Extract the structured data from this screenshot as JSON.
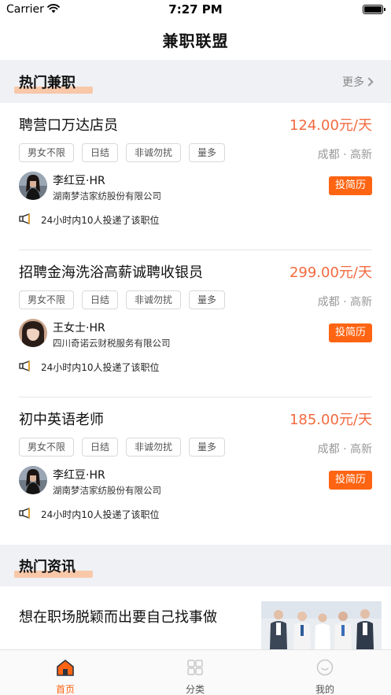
{
  "status": {
    "carrier": "Carrier",
    "time": "7:27 PM"
  },
  "nav": {
    "title": "兼职联盟"
  },
  "hot_jobs": {
    "title": "热门兼职",
    "more": "更多"
  },
  "jobs": [
    {
      "title": "聘营口万达店员",
      "salary": "124.00元/天",
      "tags": [
        "男女不限",
        "日结",
        "非诚勿扰",
        "量多"
      ],
      "location": "成都 · 高新",
      "hr_name": "李红豆·HR",
      "company": "湖南梦洁家纺股份有限公司",
      "apply": "投简历",
      "applied_note": "24小时内10人投递了该职位"
    },
    {
      "title": "招聘金海洗浴高薪诚聘收银员",
      "salary": "299.00元/天",
      "tags": [
        "男女不限",
        "日结",
        "非诚勿扰",
        "量多"
      ],
      "location": "成都 · 高新",
      "hr_name": "王女士·HR",
      "company": "四川奇诺云财税服务有限公司",
      "apply": "投简历",
      "applied_note": "24小时内10人投递了该职位"
    },
    {
      "title": "初中英语老师",
      "salary": "185.00元/天",
      "tags": [
        "男女不限",
        "日结",
        "非诚勿扰",
        "量多"
      ],
      "location": "成都 · 高新",
      "hr_name": "李红豆·HR",
      "company": "湖南梦洁家纺股份有限公司",
      "apply": "投简历",
      "applied_note": "24小时内10人投递了该职位"
    }
  ],
  "hot_news": {
    "title": "热门资讯",
    "items": [
      {
        "title": "想在职场脱颖而出要自己找事做"
      }
    ]
  },
  "tabs": [
    {
      "label": "首页",
      "icon": "home-icon",
      "active": true
    },
    {
      "label": "分类",
      "icon": "grid-icon",
      "active": false
    },
    {
      "label": "我的",
      "icon": "user-icon",
      "active": false
    }
  ],
  "colors": {
    "accent": "#fe6412",
    "salary": "#f26a3f",
    "highlight": "#f8c8a9",
    "section_bg": "#eff1f4",
    "tab_inactive": "#b0b0b0"
  }
}
